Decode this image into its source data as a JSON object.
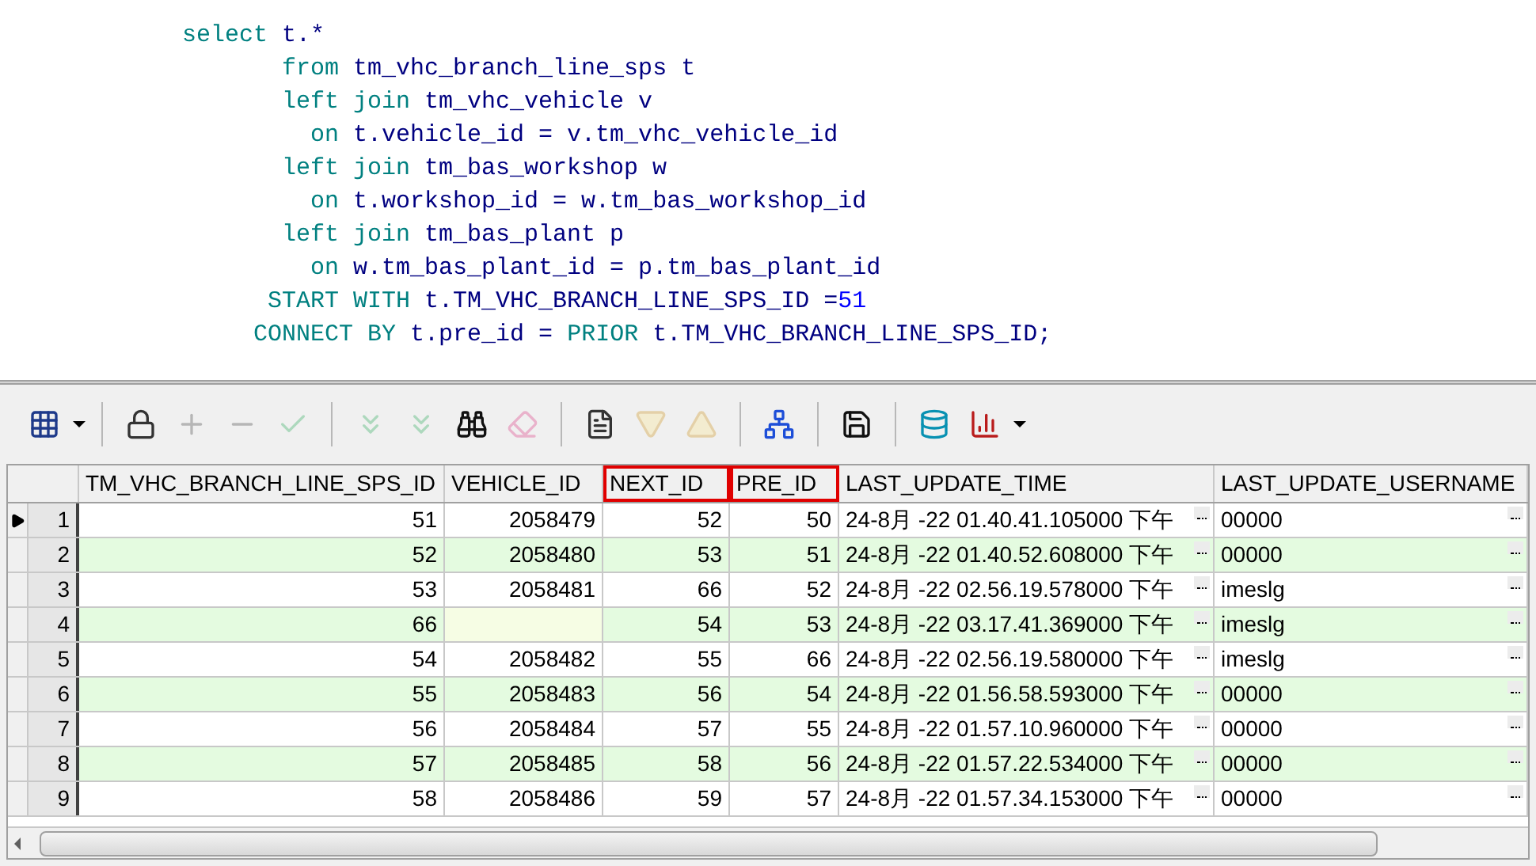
{
  "editor": {
    "lines": [
      [
        {
          "kind": "kw",
          "text": "select"
        },
        {
          "kind": "id",
          "text": " t.*"
        }
      ],
      [
        {
          "kind": "kw",
          "text": "       from"
        },
        {
          "kind": "id",
          "text": " tm_vhc_branch_line_sps t"
        }
      ],
      [
        {
          "kind": "kw",
          "text": "       left join"
        },
        {
          "kind": "id",
          "text": " tm_vhc_vehicle v"
        }
      ],
      [
        {
          "kind": "kw",
          "text": "         on"
        },
        {
          "kind": "id",
          "text": " t.vehicle_id = v.tm_vhc_vehicle_id"
        }
      ],
      [
        {
          "kind": "kw",
          "text": "       left join"
        },
        {
          "kind": "id",
          "text": " tm_bas_workshop w"
        }
      ],
      [
        {
          "kind": "kw",
          "text": "         on"
        },
        {
          "kind": "id",
          "text": " t.workshop_id = w.tm_bas_workshop_id"
        }
      ],
      [
        {
          "kind": "kw",
          "text": "       left join"
        },
        {
          "kind": "id",
          "text": " tm_bas_plant p"
        }
      ],
      [
        {
          "kind": "kw",
          "text": "         on"
        },
        {
          "kind": "id",
          "text": " w.tm_bas_plant_id = p.tm_bas_plant_id"
        }
      ],
      [
        {
          "kind": "kw",
          "text": "      START WITH"
        },
        {
          "kind": "id",
          "text": " t.TM_VHC_BRANCH_LINE_SPS_ID ="
        },
        {
          "kind": "num",
          "text": "51"
        }
      ],
      [
        {
          "kind": "kw",
          "text": "     CONNECT BY"
        },
        {
          "kind": "id",
          "text": " t.pre_id = "
        },
        {
          "kind": "kw",
          "text": "PRIOR"
        },
        {
          "kind": "id",
          "text": " t.TM_VHC_BRANCH_LINE_SPS_ID;"
        }
      ]
    ]
  },
  "toolbar": [
    {
      "kind": "grid",
      "disabled": false
    },
    {
      "kind": "dropdown",
      "disabled": false
    },
    {
      "kind": "sep"
    },
    {
      "kind": "lock",
      "disabled": false
    },
    {
      "kind": "plus",
      "disabled": true
    },
    {
      "kind": "minus",
      "disabled": true
    },
    {
      "kind": "check",
      "disabled": true
    },
    {
      "kind": "sep"
    },
    {
      "kind": "next",
      "disabled": true
    },
    {
      "kind": "last",
      "disabled": true
    },
    {
      "kind": "find",
      "disabled": false
    },
    {
      "kind": "clear",
      "disabled": true
    },
    {
      "kind": "sep"
    },
    {
      "kind": "export",
      "disabled": false
    },
    {
      "kind": "down",
      "disabled": true
    },
    {
      "kind": "up",
      "disabled": true
    },
    {
      "kind": "sep"
    },
    {
      "kind": "tree",
      "disabled": false
    },
    {
      "kind": "sep"
    },
    {
      "kind": "save",
      "disabled": false
    },
    {
      "kind": "sep"
    },
    {
      "kind": "db",
      "disabled": false
    },
    {
      "kind": "chart",
      "disabled": false
    },
    {
      "kind": "dropdown",
      "disabled": false
    }
  ],
  "table": {
    "columns": [
      {
        "label": "TM_VHC_BRANCH_LINE_SPS_ID",
        "kind": "number",
        "highlighted": false
      },
      {
        "label": "VEHICLE_ID",
        "kind": "number",
        "highlighted": false
      },
      {
        "label": "NEXT_ID",
        "kind": "number",
        "highlighted": true
      },
      {
        "label": "PRE_ID",
        "kind": "number",
        "highlighted": true
      },
      {
        "label": "LAST_UPDATE_TIME",
        "kind": "text",
        "highlighted": false
      },
      {
        "label": "LAST_UPDATE_USERNAME",
        "kind": "text",
        "highlighted": false
      }
    ],
    "rows": [
      {
        "number": "1",
        "selected": true,
        "cells": [
          "51",
          "2058479",
          "52",
          "50",
          "24-8月 -22 01.40.41.105000 下午",
          "00000"
        ]
      },
      {
        "number": "2",
        "selected": false,
        "cells": [
          "52",
          "2058480",
          "53",
          "51",
          "24-8月 -22 01.40.52.608000 下午",
          "00000"
        ]
      },
      {
        "number": "3",
        "selected": false,
        "cells": [
          "53",
          "2058481",
          "66",
          "52",
          "24-8月 -22 02.56.19.578000 下午",
          "imeslg"
        ]
      },
      {
        "number": "4",
        "selected": false,
        "cells": [
          "66",
          null,
          "54",
          "53",
          "24-8月 -22 03.17.41.369000 下午",
          "imeslg"
        ]
      },
      {
        "number": "5",
        "selected": false,
        "cells": [
          "54",
          "2058482",
          "55",
          "66",
          "24-8月 -22 02.56.19.580000 下午",
          "imeslg"
        ]
      },
      {
        "number": "6",
        "selected": false,
        "cells": [
          "55",
          "2058483",
          "56",
          "54",
          "24-8月 -22 01.56.58.593000 下午",
          "00000"
        ]
      },
      {
        "number": "7",
        "selected": false,
        "cells": [
          "56",
          "2058484",
          "57",
          "55",
          "24-8月 -22 01.57.10.960000 下午",
          "00000"
        ]
      },
      {
        "number": "8",
        "selected": false,
        "cells": [
          "57",
          "2058485",
          "58",
          "56",
          "24-8月 -22 01.57.22.534000 下午",
          "00000"
        ]
      },
      {
        "number": "9",
        "selected": false,
        "cells": [
          "58",
          "2058486",
          "59",
          "57",
          "24-8月 -22 01.57.34.153000 下午",
          "00000"
        ]
      }
    ]
  }
}
